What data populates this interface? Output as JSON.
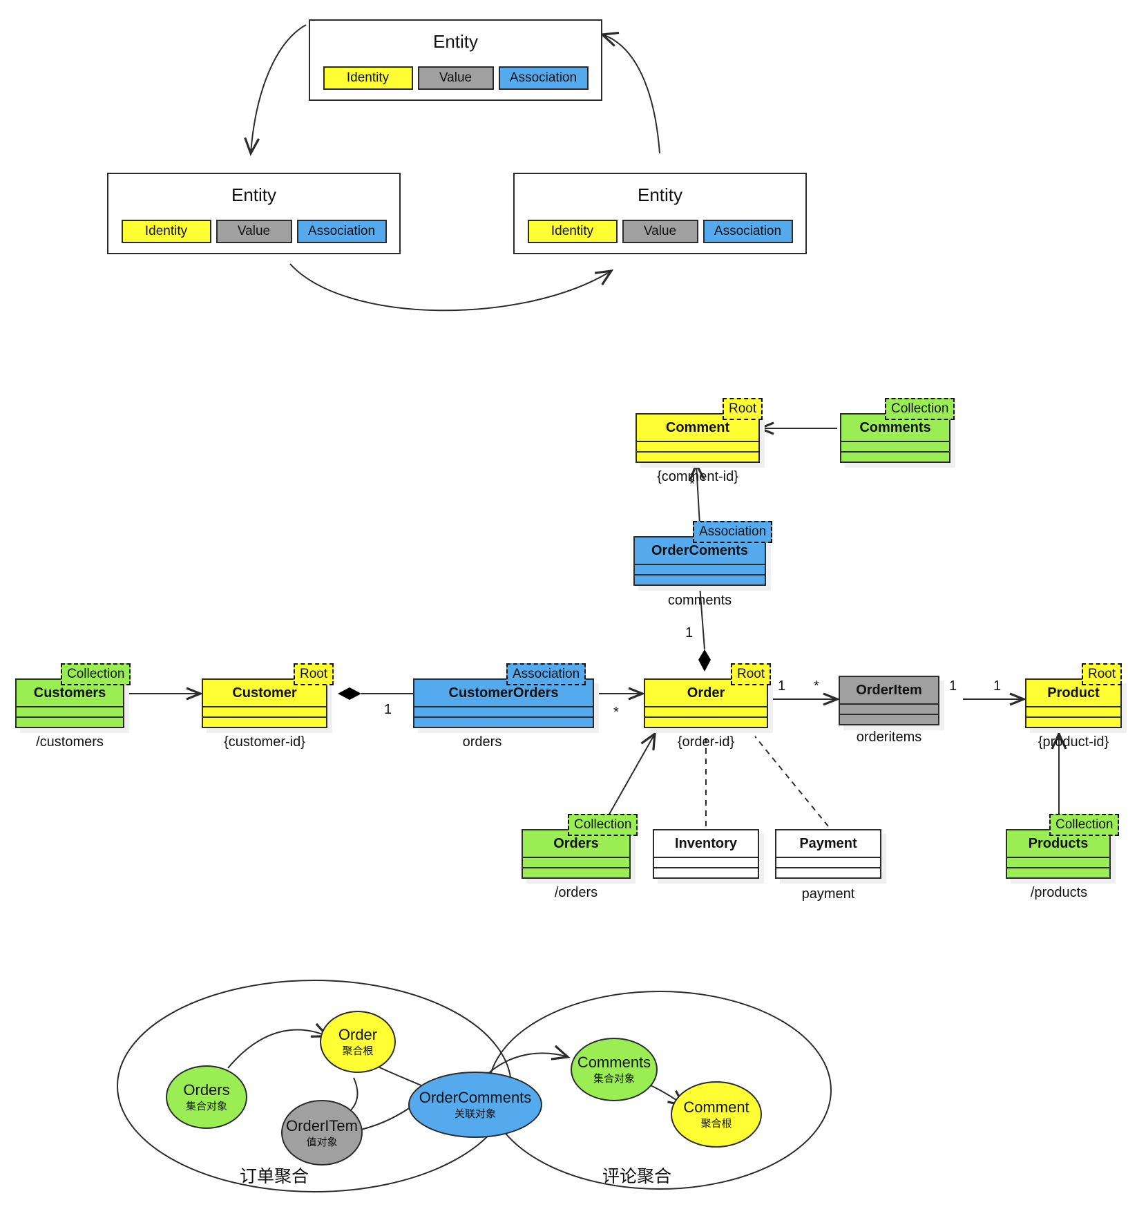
{
  "colors": {
    "identity_yellow": "#ffff33",
    "value_gray": "#a0a0a0",
    "association_blue": "#55aaee",
    "collection_green": "#9bed54",
    "plain_white": "#ffffff",
    "stroke": "#2b2b2b"
  },
  "entity_section": {
    "boxes": [
      {
        "title": "Entity",
        "slots": [
          {
            "label": "Identity",
            "kind": "identity"
          },
          {
            "label": "Value",
            "kind": "value"
          },
          {
            "label": "Association",
            "kind": "association"
          }
        ]
      },
      {
        "title": "Entity",
        "slots": [
          {
            "label": "Identity",
            "kind": "identity"
          },
          {
            "label": "Value",
            "kind": "value"
          },
          {
            "label": "Association",
            "kind": "association"
          }
        ]
      },
      {
        "title": "Entity",
        "slots": [
          {
            "label": "Identity",
            "kind": "identity"
          },
          {
            "label": "Value",
            "kind": "value"
          },
          {
            "label": "Association",
            "kind": "association"
          }
        ]
      }
    ]
  },
  "class_section": {
    "classes": [
      {
        "name": "Customers",
        "badge": "Collection",
        "caption": "/customers",
        "fill": "green"
      },
      {
        "name": "Customer",
        "badge": "Root",
        "caption": "{customer-id}",
        "fill": "yellow"
      },
      {
        "name": "CustomerOrders",
        "badge": "Association",
        "caption": "orders",
        "fill": "blue"
      },
      {
        "name": "Order",
        "badge": "Root",
        "caption": "{order-id}",
        "fill": "yellow"
      },
      {
        "name": "OrderItem",
        "badge": "",
        "caption": "orderitems",
        "fill": "gray"
      },
      {
        "name": "Product",
        "badge": "Root",
        "caption": "{product-id}",
        "fill": "yellow"
      },
      {
        "name": "Comment",
        "badge": "Root",
        "caption": "{comment-id}",
        "fill": "yellow"
      },
      {
        "name": "Comments",
        "badge": "Collection",
        "caption": "",
        "fill": "green"
      },
      {
        "name": "OrderComents",
        "badge": "Association",
        "caption": "comments",
        "fill": "blue"
      },
      {
        "name": "Orders",
        "badge": "Collection",
        "caption": "/orders",
        "fill": "green"
      },
      {
        "name": "Inventory",
        "badge": "",
        "caption": "",
        "fill": "white"
      },
      {
        "name": "Payment",
        "badge": "",
        "caption": "payment",
        "fill": "white"
      },
      {
        "name": "Products",
        "badge": "Collection",
        "caption": "/products",
        "fill": "green"
      }
    ],
    "multiplicities": {
      "customer_orders": "1",
      "orders_order": "*",
      "order_item_left": "1",
      "order_item_star": "*",
      "item_product_left": "1",
      "item_product_right": "1",
      "ordercoments_order": "1",
      "comment_star": "*"
    }
  },
  "aggregate_section": {
    "groups": [
      {
        "label": "订单聚合"
      },
      {
        "label": "评论聚合"
      }
    ],
    "nodes": [
      {
        "title": "Orders",
        "subtitle": "集合对象",
        "fill": "green"
      },
      {
        "title": "Order",
        "subtitle": "聚合根",
        "fill": "yellow"
      },
      {
        "title": "OrderITem",
        "subtitle": "值对象",
        "fill": "gray"
      },
      {
        "title": "OrderComments",
        "subtitle": "关联对象",
        "fill": "blue"
      },
      {
        "title": "Comments",
        "subtitle": "集合对象",
        "fill": "green"
      },
      {
        "title": "Comment",
        "subtitle": "聚合根",
        "fill": "yellow"
      }
    ]
  }
}
